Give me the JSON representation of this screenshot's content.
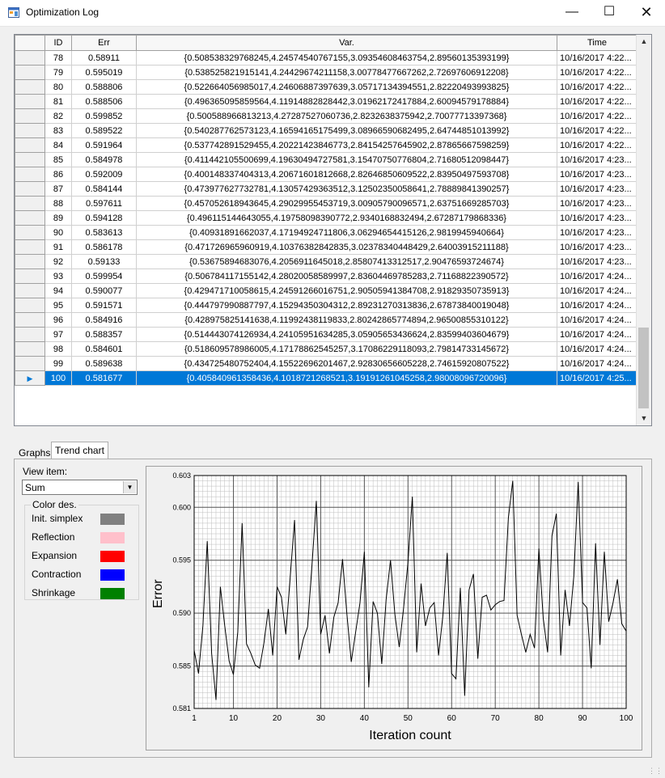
{
  "window": {
    "title": "Optimization Log",
    "min_icon": "minimize-icon",
    "max_icon": "maximize-icon",
    "close_icon": "close-icon"
  },
  "grid": {
    "columns": [
      "ID",
      "Err",
      "Var.",
      "Time"
    ],
    "rows": [
      {
        "id": "78",
        "err": "0.58911",
        "var": "{0.508538329768245,4.24574540767155,3.09354608463754,2.89560135393199}",
        "time": "10/16/2017 4:22..."
      },
      {
        "id": "79",
        "err": "0.595019",
        "var": "{0.538525821915141,4.24429674211158,3.00778477667262,2.72697606912208}",
        "time": "10/16/2017 4:22..."
      },
      {
        "id": "80",
        "err": "0.588806",
        "var": "{0.522664056985017,4.24606887397639,3.05717134394551,2.82220493993825}",
        "time": "10/16/2017 4:22..."
      },
      {
        "id": "81",
        "err": "0.588506",
        "var": "{0.496365095859564,4.11914882828442,3.01962172417884,2.60094579178884}",
        "time": "10/16/2017 4:22..."
      },
      {
        "id": "82",
        "err": "0.599852",
        "var": "{0.500588966813213,4.27287527060736,2.8232638375942,2.70077713397368}",
        "time": "10/16/2017 4:22..."
      },
      {
        "id": "83",
        "err": "0.589522",
        "var": "{0.540287762573123,4.16594165175499,3.08966590682495,2.64744851013992}",
        "time": "10/16/2017 4:22..."
      },
      {
        "id": "84",
        "err": "0.591964",
        "var": "{0.537742891529455,4.20221423846773,2.84154257645902,2.87865667598259}",
        "time": "10/16/2017 4:22..."
      },
      {
        "id": "85",
        "err": "0.584978",
        "var": "{0.411442105500699,4.19630494727581,3.15470750776804,2.71680512098447}",
        "time": "10/16/2017 4:23..."
      },
      {
        "id": "86",
        "err": "0.592009",
        "var": "{0.400148337404313,4.20671601812668,2.82646850609522,2.83950497593708}",
        "time": "10/16/2017 4:23..."
      },
      {
        "id": "87",
        "err": "0.584144",
        "var": "{0.473977627732781,4.13057429363512,3.12502350058641,2.78889841390257}",
        "time": "10/16/2017 4:23..."
      },
      {
        "id": "88",
        "err": "0.597611",
        "var": "{0.457052618943645,4.29029955453719,3.00905790096571,2.63751669285703}",
        "time": "10/16/2017 4:23..."
      },
      {
        "id": "89",
        "err": "0.594128",
        "var": "{0.496115144643055,4.19758098390772,2.9340168832494,2.67287179868336}",
        "time": "10/16/2017 4:23..."
      },
      {
        "id": "90",
        "err": "0.583613",
        "var": "{0.40931891662037,4.17194924711806,3.06294654415126,2.9819945940664}",
        "time": "10/16/2017 4:23..."
      },
      {
        "id": "91",
        "err": "0.586178",
        "var": "{0.471726965960919,4.10376382842835,3.02378340448429,2.64003915211188}",
        "time": "10/16/2017 4:23..."
      },
      {
        "id": "92",
        "err": "0.59133",
        "var": "{0.53675894683076,4.2056911645018,2.85807413312517,2.90476593724674}",
        "time": "10/16/2017 4:23..."
      },
      {
        "id": "93",
        "err": "0.599954",
        "var": "{0.506784117155142,4.28020058589997,2.83604469785283,2.71168822390572}",
        "time": "10/16/2017 4:24..."
      },
      {
        "id": "94",
        "err": "0.590077",
        "var": "{0.429471710058615,4.24591266016751,2.90505941384708,2.91829350735913}",
        "time": "10/16/2017 4:24..."
      },
      {
        "id": "95",
        "err": "0.591571",
        "var": "{0.444797990887797,4.15294350304312,2.89231270313836,2.67873840019048}",
        "time": "10/16/2017 4:24..."
      },
      {
        "id": "96",
        "err": "0.584916",
        "var": "{0.428975825141638,4.11992438119833,2.80242865774894,2.96500855310122}",
        "time": "10/16/2017 4:24..."
      },
      {
        "id": "97",
        "err": "0.588357",
        "var": "{0.514443074126934,4.24105951634285,3.05905653436624,2.83599403604679}",
        "time": "10/16/2017 4:24..."
      },
      {
        "id": "98",
        "err": "0.584601",
        "var": "{0.518609578986005,4.17178862545257,3.17086229118093,2.79814733145672}",
        "time": "10/16/2017 4:24..."
      },
      {
        "id": "99",
        "err": "0.589638",
        "var": "{0.434725480752404,4.15522696201467,2.92830656605228,2.74615920807522}",
        "time": "10/16/2017 4:24..."
      },
      {
        "id": "100",
        "err": "0.581677",
        "var": "{0.405840961358436,4.1018721268521,3.19191261045258,2.98008096720096}",
        "time": "10/16/2017 4:25..."
      }
    ],
    "selected_id": "100"
  },
  "tabs": [
    {
      "label": "Graphs"
    },
    {
      "label": "Trend chart"
    }
  ],
  "view": {
    "label": "View item:",
    "selected": "Sum"
  },
  "legend": {
    "title": "Color des.",
    "items": [
      {
        "label": "Init. simplex",
        "color": "#808080"
      },
      {
        "label": "Reflection",
        "color": "#ffc0cb"
      },
      {
        "label": "Expansion",
        "color": "#ff0000"
      },
      {
        "label": "Contraction",
        "color": "#0000ff"
      },
      {
        "label": "Shrinkage",
        "color": "#008000"
      }
    ]
  },
  "chart_data": {
    "type": "line",
    "xlabel": "Iteration count",
    "ylabel": "Error",
    "xlim": [
      1,
      100
    ],
    "ylim": [
      0.581,
      0.603
    ],
    "x_ticks": [
      1,
      10,
      20,
      30,
      40,
      50,
      60,
      70,
      80,
      90,
      100
    ],
    "y_ticks": [
      0.581,
      0.585,
      0.59,
      0.595,
      0.6,
      0.603
    ],
    "y_tick_labels": [
      "0.581",
      "0.585",
      "0.590",
      "0.595",
      "0.600",
      "0.603"
    ],
    "grid": true,
    "series": [
      {
        "color": "#000000",
        "x": [
          1,
          2,
          3,
          4,
          5,
          6,
          7,
          8,
          9,
          10,
          11,
          12,
          13,
          14,
          15,
          16,
          17,
          18,
          19,
          20,
          21,
          22,
          23,
          24,
          25,
          26,
          27,
          28,
          29,
          30,
          31,
          32,
          33,
          34,
          35,
          36,
          37,
          38,
          39,
          40,
          41,
          42,
          43,
          44,
          45,
          46,
          47,
          48,
          49,
          50,
          51,
          52,
          53,
          54,
          55,
          56,
          57,
          58,
          59,
          60,
          61,
          62,
          63,
          64,
          65,
          66,
          67,
          68,
          69,
          70,
          71,
          72,
          73,
          74,
          75,
          76,
          77,
          78,
          79,
          80,
          81,
          82,
          83,
          84,
          85,
          86,
          87,
          88,
          89,
          90,
          91,
          92,
          93,
          94,
          95,
          96,
          97,
          98,
          99,
          100
        ],
        "values": [
          0.5865,
          0.5843,
          0.5888,
          0.5968,
          0.5862,
          0.5818,
          0.5925,
          0.5888,
          0.5855,
          0.5842,
          0.5882,
          0.5985,
          0.5871,
          0.5862,
          0.5851,
          0.5848,
          0.5872,
          0.5904,
          0.586,
          0.5925,
          0.5915,
          0.588,
          0.5934,
          0.5988,
          0.5856,
          0.5875,
          0.5887,
          0.5945,
          0.6006,
          0.588,
          0.5898,
          0.5862,
          0.5896,
          0.591,
          0.5951,
          0.5899,
          0.5854,
          0.5882,
          0.591,
          0.5958,
          0.583,
          0.5911,
          0.59,
          0.5852,
          0.5913,
          0.595,
          0.5899,
          0.5868,
          0.5905,
          0.5948,
          0.601,
          0.5863,
          0.5928,
          0.5888,
          0.5905,
          0.591,
          0.586,
          0.5898,
          0.5957,
          0.5843,
          0.5838,
          0.5924,
          0.5822,
          0.5922,
          0.5937,
          0.5857,
          0.5915,
          0.5917,
          0.5903,
          0.5908,
          0.5911,
          0.5912,
          0.599,
          0.6025,
          0.5898,
          0.588,
          0.5863,
          0.588,
          0.5867,
          0.5961,
          0.5895,
          0.5863,
          0.5973,
          0.5994,
          0.586,
          0.5922,
          0.5888,
          0.5935,
          0.6024,
          0.591,
          0.5905,
          0.5848,
          0.5966,
          0.587,
          0.5958,
          0.5892,
          0.591,
          0.5932,
          0.589,
          0.5883
        ]
      }
    ]
  }
}
